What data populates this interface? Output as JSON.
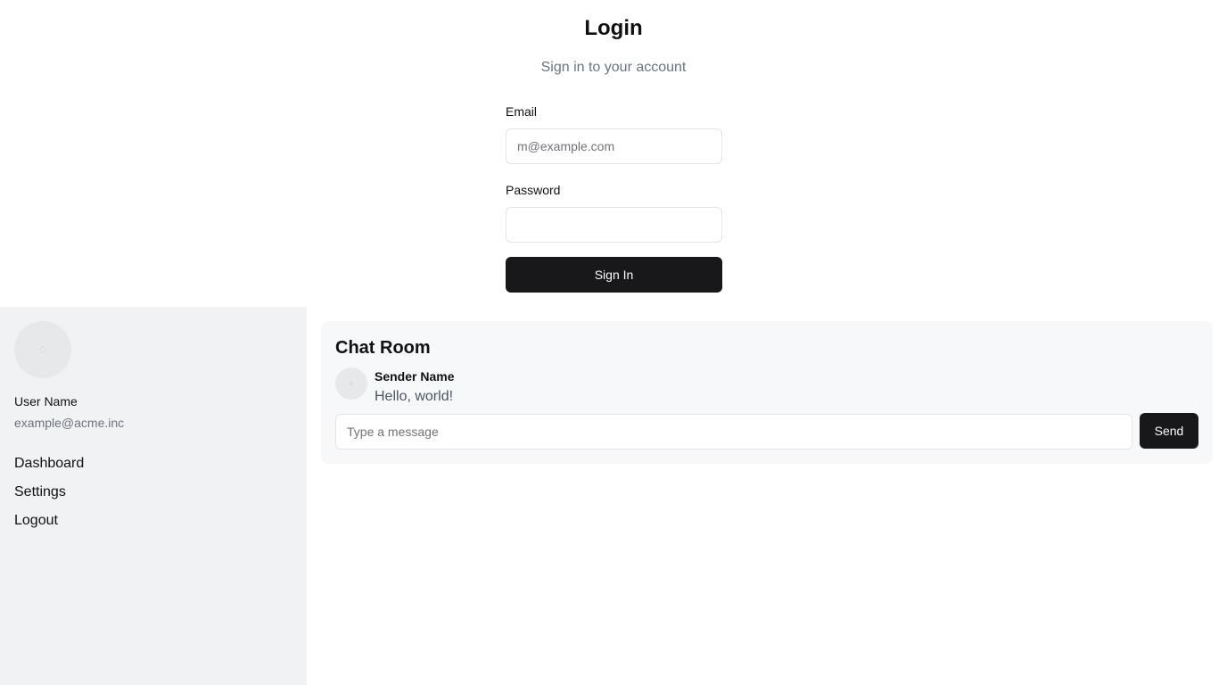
{
  "login": {
    "title": "Login",
    "subtitle": "Sign in to your account",
    "email_label": "Email",
    "email_placeholder": "m@example.com",
    "email_value": "",
    "password_label": "Password",
    "password_value": "",
    "submit_label": "Sign In"
  },
  "sidebar": {
    "avatar_icon": "user-avatar-placeholder",
    "user_name": "User Name",
    "user_email": "example@acme.inc",
    "nav": [
      {
        "label": "Dashboard"
      },
      {
        "label": "Settings"
      },
      {
        "label": "Logout"
      }
    ]
  },
  "chat": {
    "title": "Chat Room",
    "messages": [
      {
        "sender": "Sender Name",
        "text": "Hello, world!"
      }
    ],
    "input_placeholder": "Type a message",
    "input_value": "",
    "send_label": "Send"
  },
  "colors": {
    "primary": "#18181b",
    "muted_text": "#6b7280",
    "sidebar_bg": "#f1f2f4",
    "chat_bg": "#f7f8fa",
    "border": "#e4e4e7"
  }
}
